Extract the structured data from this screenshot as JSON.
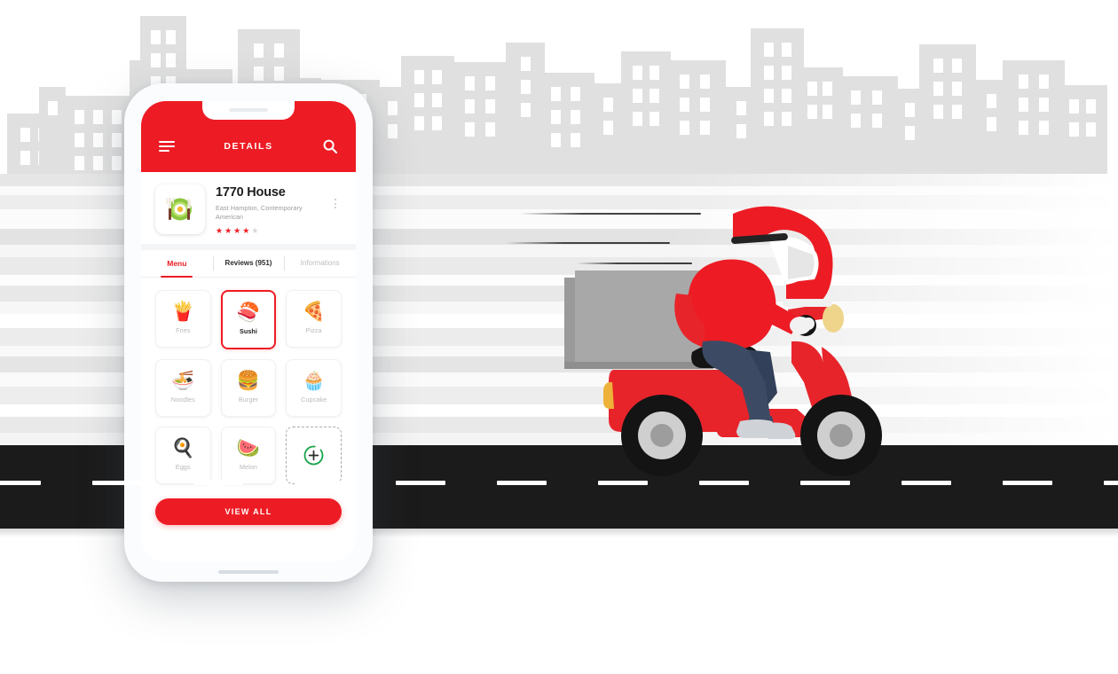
{
  "theme": {
    "brand_red": "#ed1c24",
    "road_black": "#1b1b1b",
    "skyline_gray": "#e0e0e0",
    "muted_text": "#b9b9b9",
    "accent_green": "#16a34a"
  },
  "app": {
    "header": {
      "title": "DETAILS",
      "menu_icon": "hamburger-icon",
      "search_icon": "search-icon"
    },
    "restaurant": {
      "thumb_icon": "plate-egg-cutlery-icon",
      "name": "1770 House",
      "subtitle": "East Hampton, Contemporary American",
      "rating": 4,
      "rating_max": 5,
      "overflow_icon": "kebab-menu-icon"
    },
    "tabs": [
      {
        "label": "Menu",
        "state": "active"
      },
      {
        "label": "Reviews (951)",
        "state": "dark"
      },
      {
        "label": "Informations",
        "state": "muted"
      }
    ],
    "categories": [
      {
        "label": "Fries",
        "emoji": "🍟",
        "icon": "fries-icon",
        "selected": false
      },
      {
        "label": "Sushi",
        "emoji": "🍣",
        "icon": "sushi-icon",
        "selected": true
      },
      {
        "label": "Pizza",
        "emoji": "🍕",
        "icon": "pizza-icon",
        "selected": false
      },
      {
        "label": "Noodles",
        "emoji": "🍜",
        "icon": "noodles-icon",
        "selected": false
      },
      {
        "label": "Burger",
        "emoji": "🍔",
        "icon": "burger-icon",
        "selected": false
      },
      {
        "label": "Cupcake",
        "emoji": "🧁",
        "icon": "cupcake-icon",
        "selected": false
      },
      {
        "label": "Eggs",
        "emoji": "🍳",
        "icon": "eggs-icon",
        "selected": false
      },
      {
        "label": "Melon",
        "emoji": "🍉",
        "icon": "melon-icon",
        "selected": false
      }
    ],
    "add_tile": {
      "icon": "add-plus-circle-icon"
    },
    "view_all_label": "VIEW ALL"
  },
  "illustration": {
    "scene": "delivery-scooter-courier",
    "rider_helmet_color": "#ed1c24",
    "scooter_color": "#ed1c24",
    "delivery_box_color": "#a8a8a8",
    "jeans_color": "#3d4a63",
    "road_dash_count": 12,
    "speed_line_count": 3,
    "building_count": 22
  }
}
